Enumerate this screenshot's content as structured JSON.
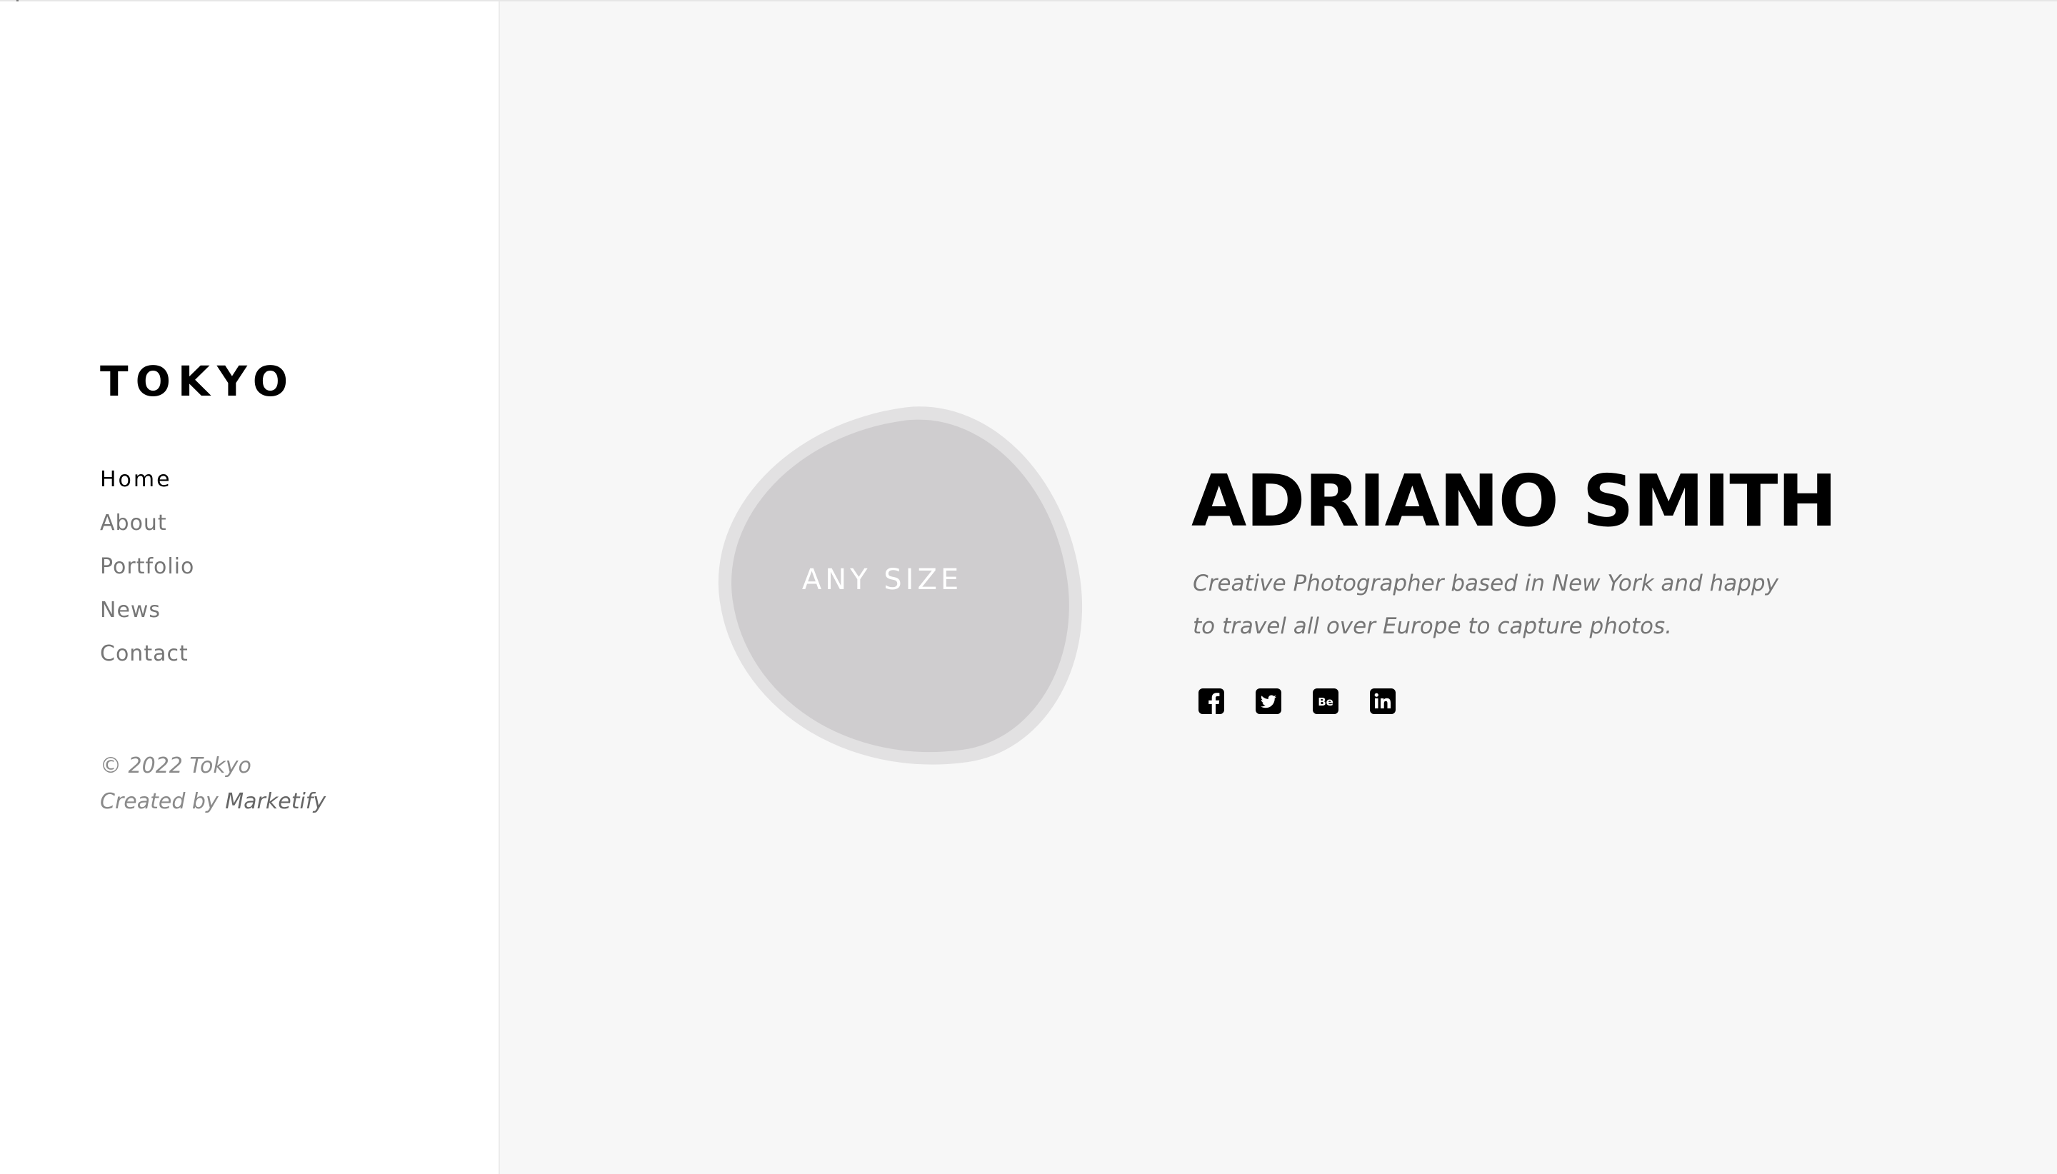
{
  "sidebar": {
    "logo": "TOKYO",
    "nav": [
      {
        "label": "Home",
        "active": true
      },
      {
        "label": "About",
        "active": false
      },
      {
        "label": "Portfolio",
        "active": false
      },
      {
        "label": "News",
        "active": false
      },
      {
        "label": "Contact",
        "active": false
      }
    ],
    "copyright": "© 2022 Tokyo",
    "created_by": "Created by",
    "created_by_link": "Marketify"
  },
  "hero": {
    "image_placeholder": "ANY SIZE",
    "name": "ADRIANO SMITH",
    "description_line1": "Creative Photographer based in New York and happy",
    "description_line2": "to travel all over Europe to capture photos.",
    "social_icons": [
      "facebook-icon",
      "twitter-icon",
      "behance-icon",
      "linkedin-icon"
    ]
  },
  "colors": {
    "sidebar_bg": "#ffffff",
    "main_bg": "#f7f7f7",
    "heading": "#000000",
    "muted_text": "#767676",
    "blob_outer": "#e2e1e2",
    "blob_inner": "#cfcdcf"
  }
}
